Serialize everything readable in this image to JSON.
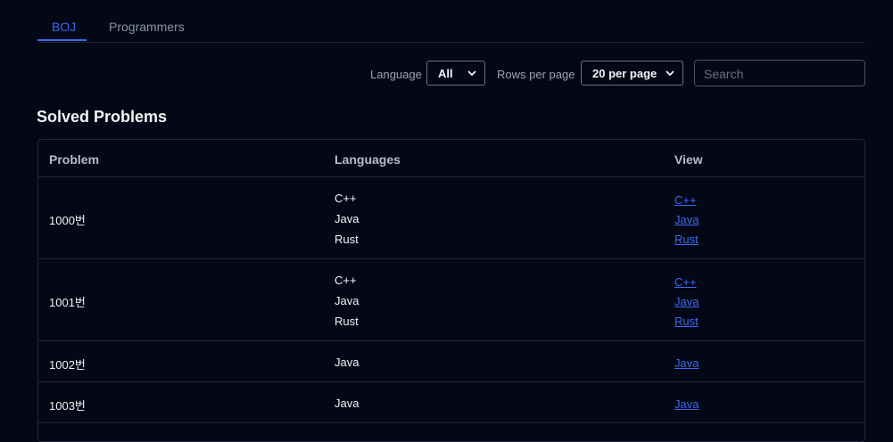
{
  "tabs": [
    {
      "label": "BOJ",
      "active": true
    },
    {
      "label": "Programmers",
      "active": false
    }
  ],
  "filters": {
    "language_label": "Language",
    "language_value": "All",
    "rows_label": "Rows per page",
    "rows_value": "20 per page",
    "search_placeholder": "Search"
  },
  "section_title": "Solved Problems",
  "table": {
    "headers": [
      "Problem",
      "Languages",
      "View"
    ],
    "rows": [
      {
        "problem": "1000번",
        "languages": [
          "C++",
          "Java",
          "Rust"
        ],
        "links": [
          "C++",
          "Java",
          "Rust"
        ]
      },
      {
        "problem": "1001번",
        "languages": [
          "C++",
          "Java",
          "Rust"
        ],
        "links": [
          "C++",
          "Java",
          "Rust"
        ]
      },
      {
        "problem": "1002번",
        "languages": [
          "Java"
        ],
        "links": [
          "Java"
        ]
      },
      {
        "problem": "1003번",
        "languages": [
          "Java"
        ],
        "links": [
          "Java"
        ]
      }
    ]
  },
  "colors": {
    "background": "#030716",
    "accent": "#3b6bf0",
    "border": "#23293a"
  }
}
